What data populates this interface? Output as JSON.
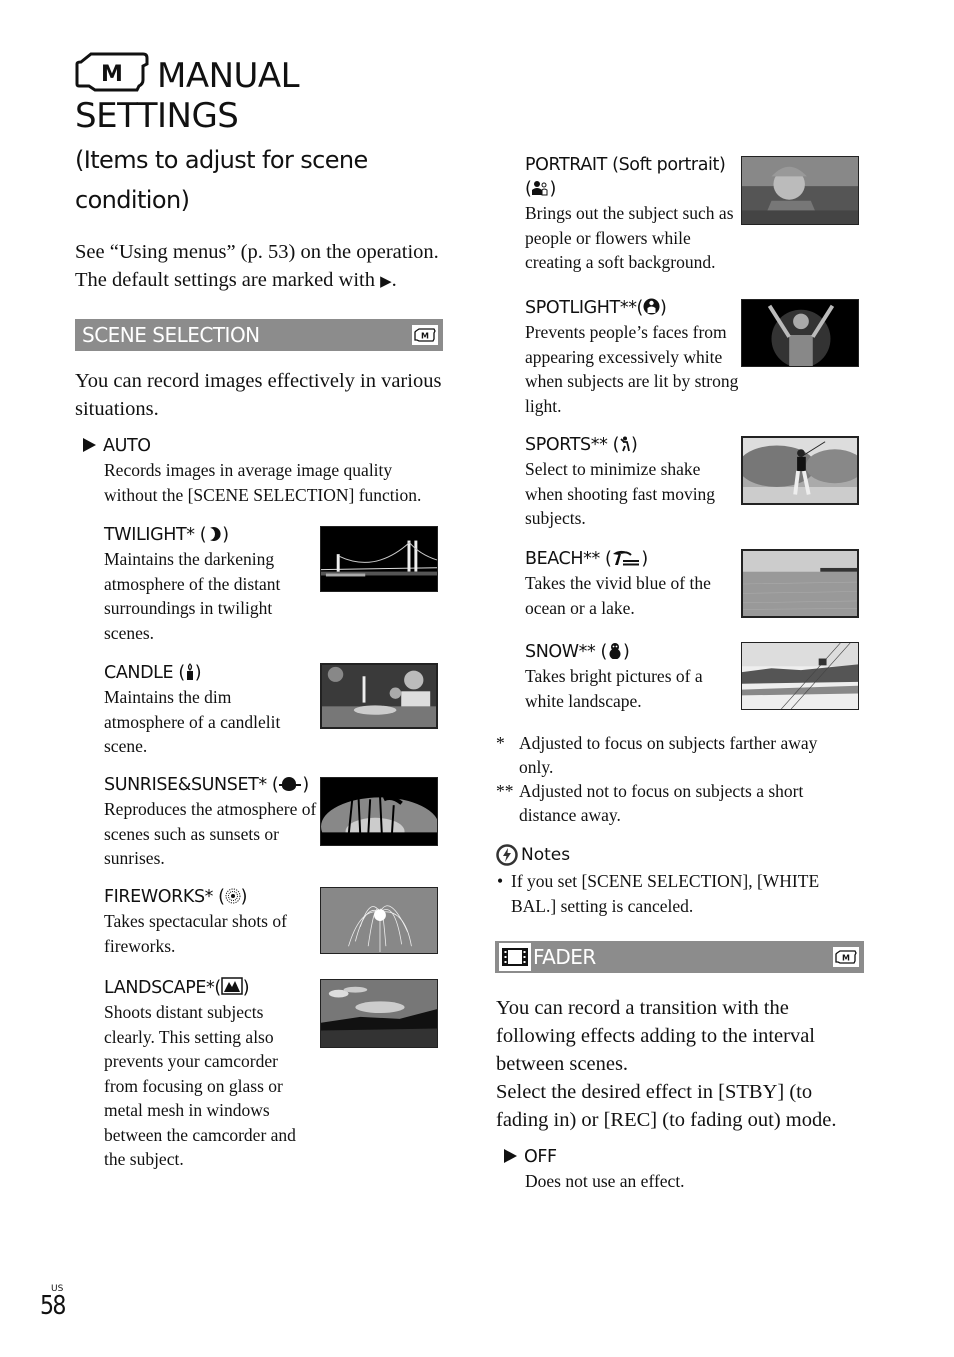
{
  "page": {
    "title_line1": "MANUAL",
    "title_line2": "SETTINGS",
    "title_icon": "manual-camera-icon",
    "subtitle": "(Items to adjust for scene condition)",
    "intro_line1": "See “Using menus” (p. 53) on the operation.",
    "intro_line2": "The default settings are marked with",
    "default_marker": "▶",
    "page_region": "US",
    "page_number": "58"
  },
  "scene_selection": {
    "header": "SCENE SELECTION",
    "header_badge_icon": "manual-mode-badge-icon",
    "description": "You can record images effectively in various situations.",
    "items": [
      {
        "name": "AUTO",
        "default": true,
        "icon": null,
        "description": "Records images in average image quality without the [SCENE SELECTION] function."
      },
      {
        "name": "TWILIGHT*",
        "icon": "moon-icon",
        "description": "Maintains the darkening atmosphere of the distant surroundings in twilight scenes.",
        "image": "night-bridge-photo"
      },
      {
        "name": "CANDLE",
        "icon": "candle-icon",
        "description": "Maintains the dim atmosphere of a candlelit scene.",
        "image": "candlelit-dinner-photo"
      },
      {
        "name": "SUNRISE&SUNSET*",
        "icon": "sunset-icon",
        "description": "Reproduces the atmosphere of scenes such as sunsets or sunrises.",
        "image": "palm-trees-sunset-photo"
      },
      {
        "name": "FIREWORKS*",
        "icon": "fireworks-icon",
        "description": "Takes spectacular shots of fireworks.",
        "image": "fireworks-photo"
      },
      {
        "name": "LANDSCAPE*",
        "icon": "mountain-icon",
        "description": "Shoots distant subjects clearly. This setting also prevents your camcorder from focusing on glass or metal mesh in windows between the camcorder and the subject.",
        "image": "landscape-field-photo"
      },
      {
        "name": "PORTRAIT (Soft portrait)",
        "icon": "portrait-icon",
        "description": "Brings out the subject such as people or flowers while creating a soft background.",
        "image": "child-portrait-photo"
      },
      {
        "name": "SPOTLIGHT**",
        "icon": "spotlight-icon",
        "description": "Prevents people’s faces from appearing excessively white when subjects are lit by strong light.",
        "image": "child-spotlight-photo"
      },
      {
        "name": "SPORTS**",
        "icon": "golfer-icon",
        "description": "Select to minimize shake when shooting fast moving subjects.",
        "image": "golfer-photo"
      },
      {
        "name": "BEACH**",
        "icon": "beach-icon",
        "description": "Takes the vivid blue of the ocean or a lake.",
        "image": "beach-photo"
      },
      {
        "name": "SNOW**",
        "icon": "snowman-icon",
        "description": "Takes bright pictures of a white landscape.",
        "image": "snow-gondola-photo"
      }
    ],
    "footnotes": [
      {
        "mark": "*",
        "text": "Adjusted to focus on subjects farther away only."
      },
      {
        "mark": "**",
        "text": "Adjusted not to focus on subjects a short distance away."
      }
    ],
    "notes": {
      "header": "Notes",
      "icon": "caution-icon",
      "bullets": [
        "If you set [SCENE SELECTION], [WHITE BAL.] setting is canceled."
      ]
    }
  },
  "fader": {
    "header": "FADER",
    "header_icon": "film-strip-icon",
    "header_badge_icon": "manual-mode-badge-icon",
    "description_1": "You can record a transition with the following effects adding to the interval between scenes.",
    "description_2": "Select the desired effect in [STBY] (to fading in) or [REC] (to fading out) mode.",
    "items": [
      {
        "name": "OFF",
        "default": true,
        "description": "Does not use an effect."
      }
    ]
  },
  "colors": {
    "section_bar": "#8c8c8c",
    "section_text": "#ffffff",
    "text": "#111111"
  }
}
